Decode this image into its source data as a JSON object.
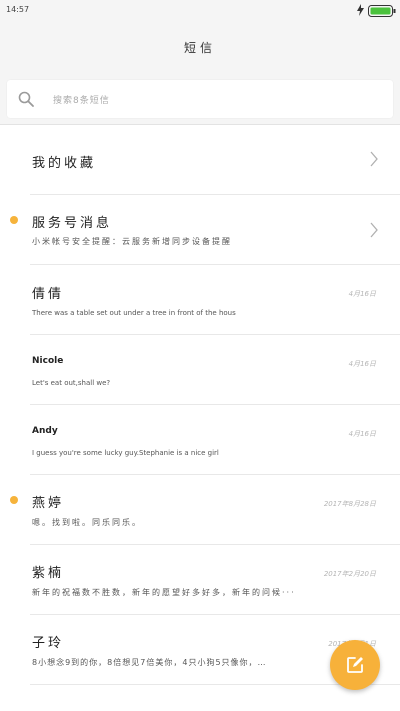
{
  "status_bar": {
    "time": "14:57"
  },
  "header": {
    "title": "短信"
  },
  "search": {
    "placeholder": "搜索8条短信"
  },
  "colors": {
    "accent": "#f7b13a",
    "unread_dot": "#f6b33b"
  },
  "conversations": [
    {
      "title": "我的收藏",
      "subtitle": "",
      "time": "",
      "unread": false,
      "chevron": true
    },
    {
      "title": "服务号消息",
      "subtitle": "小米帐号安全提醒：云服务新增同步设备提醒",
      "time": "",
      "unread": true,
      "chevron": true
    },
    {
      "title": "倩倩",
      "subtitle": "There was a table set out under a tree in front of the hous",
      "time": "4月16日",
      "unread": false,
      "chevron": false
    },
    {
      "title": "Nicole",
      "subtitle": "Let's eat out,shall we?",
      "time": "4月16日",
      "unread": false,
      "chevron": false
    },
    {
      "title": "Andy",
      "subtitle": "I guess you're some lucky guy.Stephanie is a nice girl",
      "time": "4月16日",
      "unread": false,
      "chevron": false
    },
    {
      "title": "燕婷",
      "subtitle": "嗯。找到啦。同乐同乐。",
      "time": "2017年8月28日",
      "unread": true,
      "chevron": false
    },
    {
      "title": "紫楠",
      "subtitle": "新年的祝福数不胜数，新年的愿望好多好多，新年的问候···",
      "time": "2017年2月20日",
      "unread": false,
      "chevron": false
    },
    {
      "title": "子玲",
      "subtitle": "8小想念9到的你，8倍想见7倍美你，4只小狗5只像你，…",
      "time": "2017年1月1日",
      "unread": false,
      "chevron": false
    }
  ],
  "icons": {
    "search": "search-icon",
    "chevron": "chevron-right-icon",
    "compose": "compose-icon",
    "battery": "battery-icon",
    "bolt": "bolt-icon"
  }
}
